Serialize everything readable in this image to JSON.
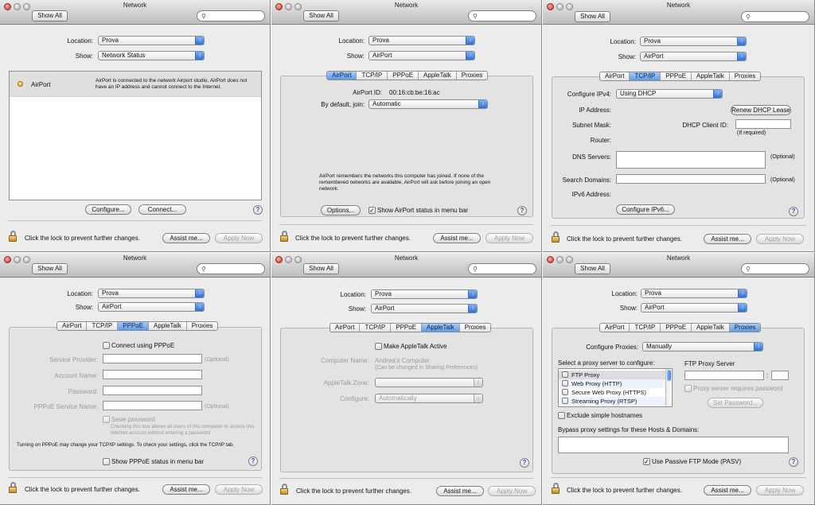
{
  "window": {
    "title": "Network",
    "show_all": "Show All",
    "location_label": "Location:",
    "location_value": "Prova",
    "show_label": "Show:",
    "lock_text": "Click the lock to prevent further changes.",
    "assist": "Assist me...",
    "apply": "Apply Now",
    "help": "?"
  },
  "tabs": [
    "AirPort",
    "TCP/IP",
    "PPPoE",
    "AppleTalk",
    "Proxies"
  ],
  "p1": {
    "show_value": "Network Status",
    "row_name": "AirPort",
    "row_status": "AirPort is connected to the network Airport studio. AirPort does not have an IP address and cannot connect to the Internet.",
    "configure": "Configure...",
    "connect": "Connect..."
  },
  "p2": {
    "show_value": "AirPort",
    "id_label": "AirPort ID:",
    "id_value": "00:16:cb:be:16:ac",
    "join_label": "By default, join:",
    "join_value": "Automatic",
    "note": "AirPort remembers the networks this computer has joined. If none of the remembered networks are available, AirPort will ask before joining an open network.",
    "options": "Options...",
    "status_check": "Show AirPort status in menu bar"
  },
  "p3": {
    "show_value": "AirPort",
    "cfg_label": "Configure IPv4:",
    "cfg_value": "Using DHCP",
    "ip_label": "IP Address:",
    "renew": "Renew DHCP Lease",
    "mask_label": "Subnet Mask:",
    "client_label": "DHCP Client ID:",
    "if_required": "(If required)",
    "router_label": "Router:",
    "dns_label": "DNS Servers:",
    "optional": "(Optional)",
    "search_label": "Search Domains:",
    "ipv6_label": "IPv6 Address:",
    "cfg_ipv6": "Configure IPv6..."
  },
  "p4": {
    "show_value": "AirPort",
    "connect_check": "Connect using PPPoE",
    "provider_label": "Service Provider:",
    "account_label": "Account Name:",
    "password_label": "Password:",
    "service_label": "PPPoE Service Name:",
    "optional": "(Optional)",
    "save_password": "Save password",
    "save_note": "Checking this box allows all users of this computer to access this Internet account without entering a password.",
    "turning_on": "Turning on PPPoE may change your TCP/IP settings. To check your settings, click the TCP/IP tab.",
    "status_check": "Show PPPoE status in menu bar"
  },
  "p5": {
    "show_value": "AirPort",
    "make_active": "Make AppleTalk Active",
    "computer_label": "Computer Name:",
    "computer_value": "Andrea's Computer",
    "computer_note": "(Can be changed in Sharing Preferences)",
    "zone_label": "AppleTalk Zone:",
    "configure_label": "Configure:",
    "configure_value": "Automatically"
  },
  "p6": {
    "show_value": "AirPort",
    "cfg_label": "Configure Proxies:",
    "cfg_value": "Manually",
    "select_label": "Select a proxy server to configure:",
    "proxies": [
      "FTP Proxy",
      "Web Proxy (HTTP)",
      "Secure Web Proxy (HTTPS)",
      "Streaming Proxy (RTSP)"
    ],
    "server_label": "FTP Proxy Server",
    "requires_pw": "Proxy server requires password",
    "set_password": "Set Password...",
    "exclude": "Exclude simple hostnames",
    "bypass_label": "Bypass proxy settings for these Hosts & Domains:",
    "passive": "Use Passive FTP Mode (PASV)"
  }
}
